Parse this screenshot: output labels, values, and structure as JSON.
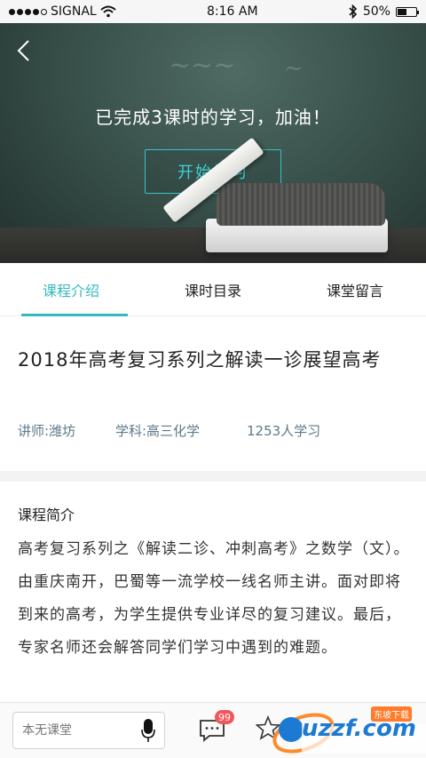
{
  "status_bar": {
    "carrier": "SIGNAL",
    "time": "8:16 AM",
    "battery": "50%",
    "battery_level": 0.5
  },
  "hero": {
    "message": "已完成3课时的学习，加油！",
    "start_button": "开始学习"
  },
  "tabs": [
    {
      "label": "课程介绍",
      "active": true
    },
    {
      "label": "课时目录",
      "active": false
    },
    {
      "label": "课堂留言",
      "active": false
    }
  ],
  "course": {
    "title": "2018年高考复习系列之解读一诊展望高考",
    "teacher": "讲师:潍坊",
    "subject": "学科:高三化学",
    "learners": "1253人学习"
  },
  "intro": {
    "heading": "课程简介",
    "text": "高考复习系列之《解读二诊、冲刺高考》之数学（文）。由重庆南开，巴蜀等一流学校一线名师主讲。面对即将到来的高考，为学生提供专业详尽的复习建议。最后，专家名师还会解答同学们学习中遇到的难题。"
  },
  "bottom_bar": {
    "comment_placeholder": "本无课堂",
    "message_badge": "99",
    "watermark_text": "uzzf.com",
    "watermark_tag": "东坡下载"
  },
  "colors": {
    "accent": "#35b9c0",
    "badge": "#f2565a"
  }
}
